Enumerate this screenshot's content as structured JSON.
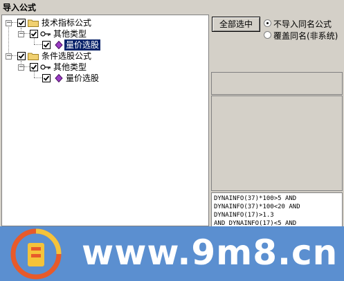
{
  "window": {
    "title": "导入公式"
  },
  "tree": {
    "root1": {
      "label": "技术指标公式",
      "child": {
        "label": "其他类型",
        "leaf": {
          "label": "量价选股"
        }
      }
    },
    "root2": {
      "label": "条件选股公式",
      "child": {
        "label": "其他类型",
        "leaf": {
          "label": "量价选股"
        }
      }
    }
  },
  "options": {
    "select_all_label": "全部选中",
    "radio1_label": "不导入同名公式",
    "radio2_label": "覆盖同名(非系统)",
    "selected": "radio1"
  },
  "code_lines": [
    "DYNAINFO(37)*100>5 AND",
    "DYNAINFO(37)*100<20 AND",
    "DYNAINFO(17)>1.3",
    "AND DYNAINFO(17)<5 AND"
  ],
  "watermark": {
    "url": "www.9m8.cn",
    "logo_text": "9m8.cn"
  }
}
